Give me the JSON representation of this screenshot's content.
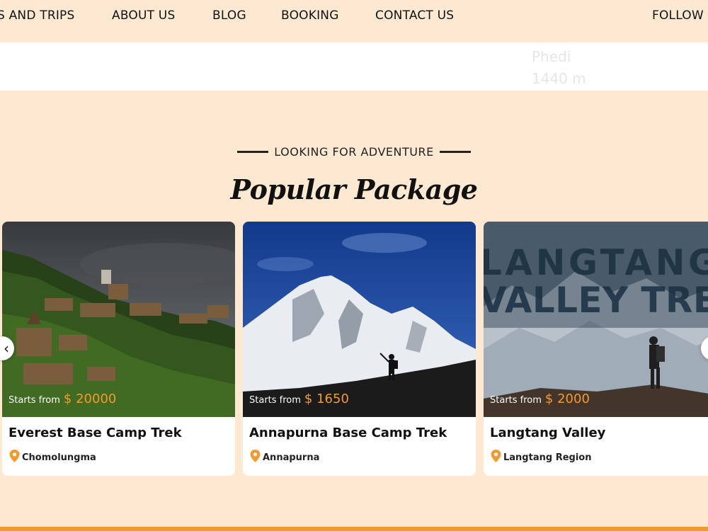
{
  "nav": {
    "items": [
      {
        "label": "S AND TRIPS"
      },
      {
        "label": "ABOUT US"
      },
      {
        "label": "BLOG"
      },
      {
        "label": "BOOKING"
      },
      {
        "label": "CONTACT US"
      },
      {
        "label": "FOLLOW"
      }
    ]
  },
  "strip": {
    "place": "Phedi",
    "altitude": "1440 m"
  },
  "section": {
    "eyebrow": "LOOKING FOR ADVENTURE",
    "title": "Popular Package"
  },
  "cards": [
    {
      "price_prefix": "Starts from",
      "price": "$ 20000",
      "name": "Everest Base Camp Trek",
      "location": "Chomolungma",
      "image": "hillside-town-photo"
    },
    {
      "price_prefix": "Starts from",
      "price": "$ 1650",
      "name": "Annapurna Base Camp Trek",
      "location": "Annapurna",
      "image": "snow-mountain-hiker-photo"
    },
    {
      "price_prefix": "Starts from",
      "price": "$ 2000",
      "name": "Langtang Valley",
      "location": "Langtang Region",
      "image": "langtang-poster-photo",
      "image_text": [
        "LANGTANG",
        "VALLEY TRE"
      ]
    }
  ],
  "carousel": {
    "prev_icon": "chevron-left-icon",
    "next_icon": "chevron-right-icon"
  },
  "colors": {
    "accent": "#f29a2e",
    "background": "#fde9d1"
  }
}
